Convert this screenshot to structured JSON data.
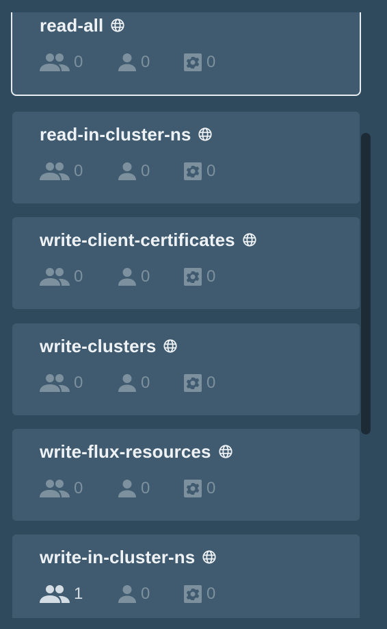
{
  "roles": [
    {
      "name": "read-all",
      "globe_icon": "globe-icon",
      "groups": "0",
      "users": "0",
      "bots": "0",
      "selected": true
    },
    {
      "name": "read-in-cluster-ns",
      "globe_icon": "globe-icon",
      "groups": "0",
      "users": "0",
      "bots": "0"
    },
    {
      "name": "write-client-certificates",
      "globe_icon": "globe-icon",
      "groups": "0",
      "users": "0",
      "bots": "0"
    },
    {
      "name": "write-clusters",
      "globe_icon": "globe-icon",
      "groups": "0",
      "users": "0",
      "bots": "0"
    },
    {
      "name": "write-flux-resources",
      "globe_icon": "globe-icon",
      "groups": "0",
      "users": "0",
      "bots": "0"
    },
    {
      "name": "write-in-cluster-ns",
      "globe_icon": "globe-icon",
      "groups": "1",
      "users": "0",
      "bots": "0"
    }
  ],
  "icons": {
    "groups": "groups-icon",
    "users": "user-icon",
    "bots": "bot-gear-icon",
    "globe": "globe-icon"
  },
  "colors": {
    "background": "#304a5d",
    "card": "#405b6f",
    "selected_border": "#e8edf1",
    "text": "#eef2f5",
    "muted": "#7d909e",
    "scrollbar": "#1c2b36"
  }
}
